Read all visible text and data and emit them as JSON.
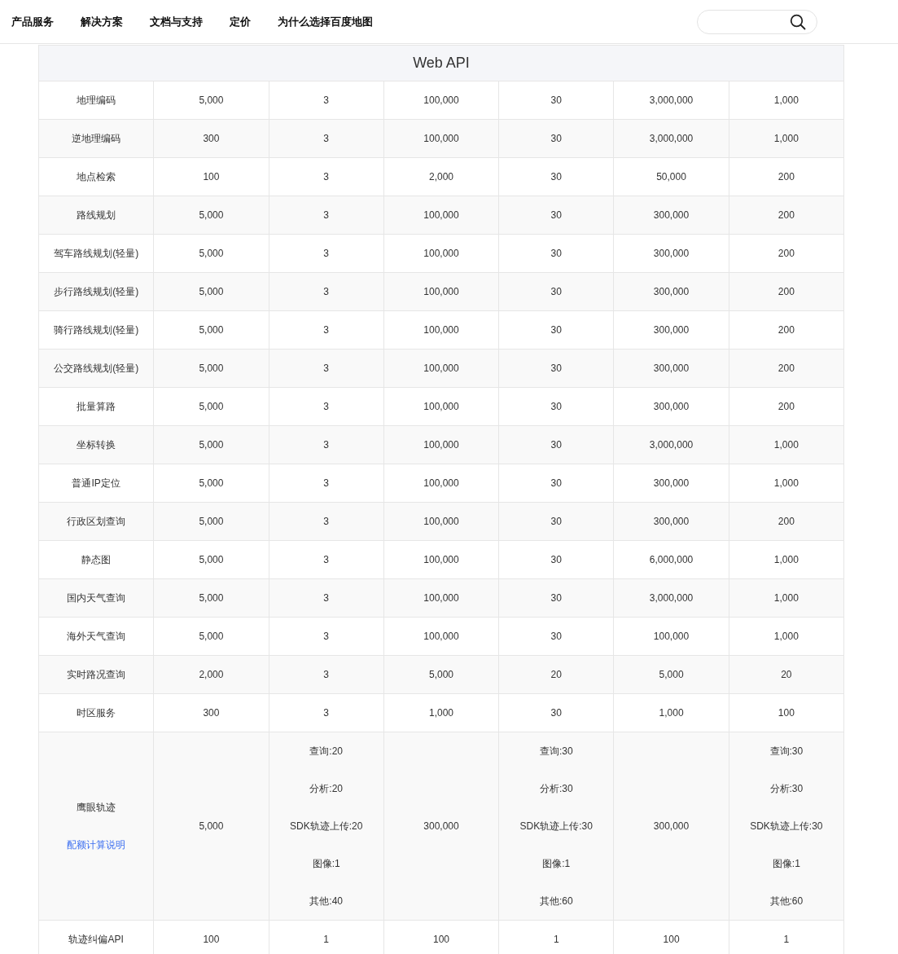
{
  "nav": {
    "items": [
      "产品服务",
      "解决方案",
      "文档与支持",
      "定价",
      "为什么选择百度地图"
    ]
  },
  "table": {
    "title": "Web API",
    "rows": [
      {
        "name": "地理编码",
        "cells": [
          [
            "5,000"
          ],
          [
            "3"
          ],
          [
            "100,000"
          ],
          [
            "30"
          ],
          [
            "3,000,000"
          ],
          [
            "1,000"
          ]
        ]
      },
      {
        "name": "逆地理编码",
        "cells": [
          [
            "300"
          ],
          [
            "3"
          ],
          [
            "100,000"
          ],
          [
            "30"
          ],
          [
            "3,000,000"
          ],
          [
            "1,000"
          ]
        ]
      },
      {
        "name": "地点检索",
        "cells": [
          [
            "100"
          ],
          [
            "3"
          ],
          [
            "2,000"
          ],
          [
            "30"
          ],
          [
            "50,000"
          ],
          [
            "200"
          ]
        ]
      },
      {
        "name": "路线规划",
        "cells": [
          [
            "5,000"
          ],
          [
            "3"
          ],
          [
            "100,000"
          ],
          [
            "30"
          ],
          [
            "300,000"
          ],
          [
            "200"
          ]
        ]
      },
      {
        "name": "驾车路线规划(轻量)",
        "cells": [
          [
            "5,000"
          ],
          [
            "3"
          ],
          [
            "100,000"
          ],
          [
            "30"
          ],
          [
            "300,000"
          ],
          [
            "200"
          ]
        ]
      },
      {
        "name": "步行路线规划(轻量)",
        "cells": [
          [
            "5,000"
          ],
          [
            "3"
          ],
          [
            "100,000"
          ],
          [
            "30"
          ],
          [
            "300,000"
          ],
          [
            "200"
          ]
        ]
      },
      {
        "name": "骑行路线规划(轻量)",
        "cells": [
          [
            "5,000"
          ],
          [
            "3"
          ],
          [
            "100,000"
          ],
          [
            "30"
          ],
          [
            "300,000"
          ],
          [
            "200"
          ]
        ]
      },
      {
        "name": "公交路线规划(轻量)",
        "cells": [
          [
            "5,000"
          ],
          [
            "3"
          ],
          [
            "100,000"
          ],
          [
            "30"
          ],
          [
            "300,000"
          ],
          [
            "200"
          ]
        ]
      },
      {
        "name": "批量算路",
        "cells": [
          [
            "5,000"
          ],
          [
            "3"
          ],
          [
            "100,000"
          ],
          [
            "30"
          ],
          [
            "300,000"
          ],
          [
            "200"
          ]
        ]
      },
      {
        "name": "坐标转换",
        "cells": [
          [
            "5,000"
          ],
          [
            "3"
          ],
          [
            "100,000"
          ],
          [
            "30"
          ],
          [
            "3,000,000"
          ],
          [
            "1,000"
          ]
        ]
      },
      {
        "name": "普通IP定位",
        "cells": [
          [
            "5,000"
          ],
          [
            "3"
          ],
          [
            "100,000"
          ],
          [
            "30"
          ],
          [
            "300,000"
          ],
          [
            "1,000"
          ]
        ]
      },
      {
        "name": "行政区划查询",
        "cells": [
          [
            "5,000"
          ],
          [
            "3"
          ],
          [
            "100,000"
          ],
          [
            "30"
          ],
          [
            "300,000"
          ],
          [
            "200"
          ]
        ]
      },
      {
        "name": "静态图",
        "cells": [
          [
            "5,000"
          ],
          [
            "3"
          ],
          [
            "100,000"
          ],
          [
            "30"
          ],
          [
            "6,000,000"
          ],
          [
            "1,000"
          ]
        ]
      },
      {
        "name": "国内天气查询",
        "cells": [
          [
            "5,000"
          ],
          [
            "3"
          ],
          [
            "100,000"
          ],
          [
            "30"
          ],
          [
            "3,000,000"
          ],
          [
            "1,000"
          ]
        ]
      },
      {
        "name": "海外天气查询",
        "cells": [
          [
            "5,000"
          ],
          [
            "3"
          ],
          [
            "100,000"
          ],
          [
            "30"
          ],
          [
            "100,000"
          ],
          [
            "1,000"
          ]
        ]
      },
      {
        "name": "实时路况查询",
        "cells": [
          [
            "2,000"
          ],
          [
            "3"
          ],
          [
            "5,000"
          ],
          [
            "20"
          ],
          [
            "5,000"
          ],
          [
            "20"
          ]
        ]
      },
      {
        "name": "时区服务",
        "cells": [
          [
            "300"
          ],
          [
            "3"
          ],
          [
            "1,000"
          ],
          [
            "30"
          ],
          [
            "1,000"
          ],
          [
            "100"
          ]
        ]
      },
      {
        "name": "鹰眼轨迹",
        "link": "配额计算说明",
        "cells": [
          [
            "5,000"
          ],
          [
            "查询:20",
            "分析:20",
            "SDK轨迹上传:20",
            "图像:1",
            "其他:40"
          ],
          [
            "300,000"
          ],
          [
            "查询:30",
            "分析:30",
            "SDK轨迹上传:30",
            "图像:1",
            "其他:60"
          ],
          [
            "300,000"
          ],
          [
            "查询:30",
            "分析:30",
            "SDK轨迹上传:30",
            "图像:1",
            "其他:60"
          ]
        ]
      },
      {
        "name": "轨迹纠偏API",
        "cells": [
          [
            "100"
          ],
          [
            "1"
          ],
          [
            "100"
          ],
          [
            "1"
          ],
          [
            "100"
          ],
          [
            "1"
          ]
        ]
      }
    ]
  }
}
